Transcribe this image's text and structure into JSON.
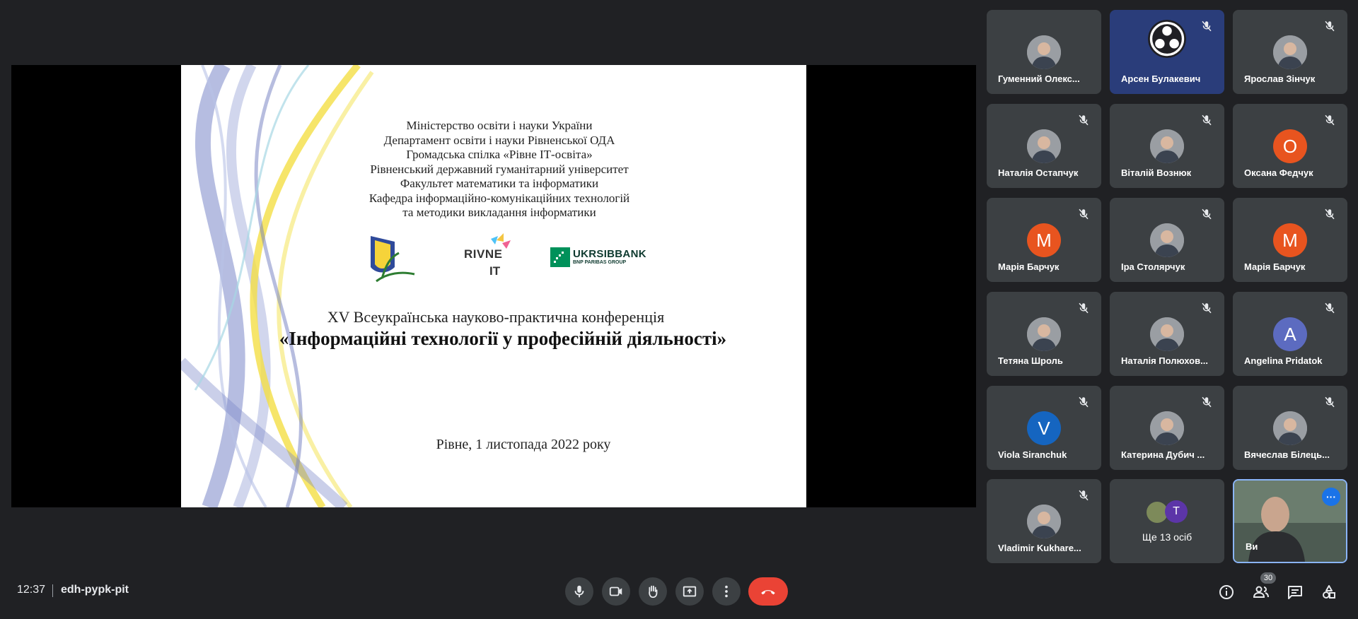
{
  "meeting": {
    "time": "12:37",
    "code": "edh-pypk-pit",
    "participant_count": "30"
  },
  "slide": {
    "org_lines": [
      "Міністерство освіти і науки України",
      "Департамент освіти і науки Рівненської ОДА",
      "Громадська спілка «Рівне ІТ-освіта»",
      "Рівненський державний гуманітарний університет",
      "Факультет математики та інформатики",
      "Кафедра інформаційно-комунікаційних технологій",
      "та методики викладання інформатики"
    ],
    "logo_rivne_line1": "RIVNE",
    "logo_rivne_line2": "IT",
    "logo_bank_name": "UKRSIBBANK",
    "logo_bank_sub": "BNP PARIBAS GROUP",
    "conference_line": "XV Всеукраїнська науково-практична конференція",
    "conference_title": "«Інформаційні технології у професійній діяльності»",
    "date_line": "Рівне, 1 листопада 2022 року"
  },
  "participants": [
    {
      "name": "Гуменний Олекс...",
      "avatar": "photo",
      "muted": false
    },
    {
      "name": "Арсен Булакевич",
      "avatar": "obs-logo",
      "muted": true
    },
    {
      "name": "Ярослав Зінчук",
      "avatar": "photo",
      "muted": true
    },
    {
      "name": "Наталія Остапчук",
      "avatar": "photo",
      "muted": true
    },
    {
      "name": "Віталій Вознюк",
      "avatar": "photo",
      "muted": true
    },
    {
      "name": "Оксана Федчук",
      "avatar": "letter",
      "letter": "О",
      "color": "#e8541f",
      "muted": true
    },
    {
      "name": "Марія Барчук",
      "avatar": "letter",
      "letter": "M",
      "color": "#e8541f",
      "muted": true
    },
    {
      "name": "Іра Столярчук",
      "avatar": "photo",
      "muted": true
    },
    {
      "name": "Марія Барчук",
      "avatar": "letter",
      "letter": "M",
      "color": "#e8541f",
      "muted": true
    },
    {
      "name": "Тетяна Шроль",
      "avatar": "photo",
      "muted": true
    },
    {
      "name": "Наталія Полюхов...",
      "avatar": "photo",
      "muted": true
    },
    {
      "name": "Angelina Pridatok",
      "avatar": "letter",
      "letter": "A",
      "color": "#5c6bc0",
      "muted": true
    },
    {
      "name": "Viola Siranchuk",
      "avatar": "letter",
      "letter": "V",
      "color": "#1565c0",
      "muted": true
    },
    {
      "name": "Катерина Дубич ...",
      "avatar": "photo",
      "muted": true
    },
    {
      "name": "Вячеслав Білець...",
      "avatar": "photo",
      "muted": true
    },
    {
      "name": "Vladimir Kukhare...",
      "avatar": "photo",
      "muted": true
    }
  ],
  "more_tile": {
    "label": "Ще 13 осіб",
    "letter": "T",
    "color": "#5c35a8"
  },
  "self_tile": {
    "name": "Ви",
    "menu_label": "···"
  },
  "controls": {
    "icons": [
      "microphone-icon",
      "camera-icon",
      "raise-hand-icon",
      "present-screen-icon",
      "more-options-icon",
      "hang-up-icon"
    ]
  },
  "side_icons": [
    "info-icon",
    "people-icon",
    "chat-icon",
    "activities-icon"
  ],
  "colors": {
    "background": "#202124",
    "tile": "#3c4043",
    "hangup": "#ea4335",
    "accent": "#1a73e8"
  }
}
